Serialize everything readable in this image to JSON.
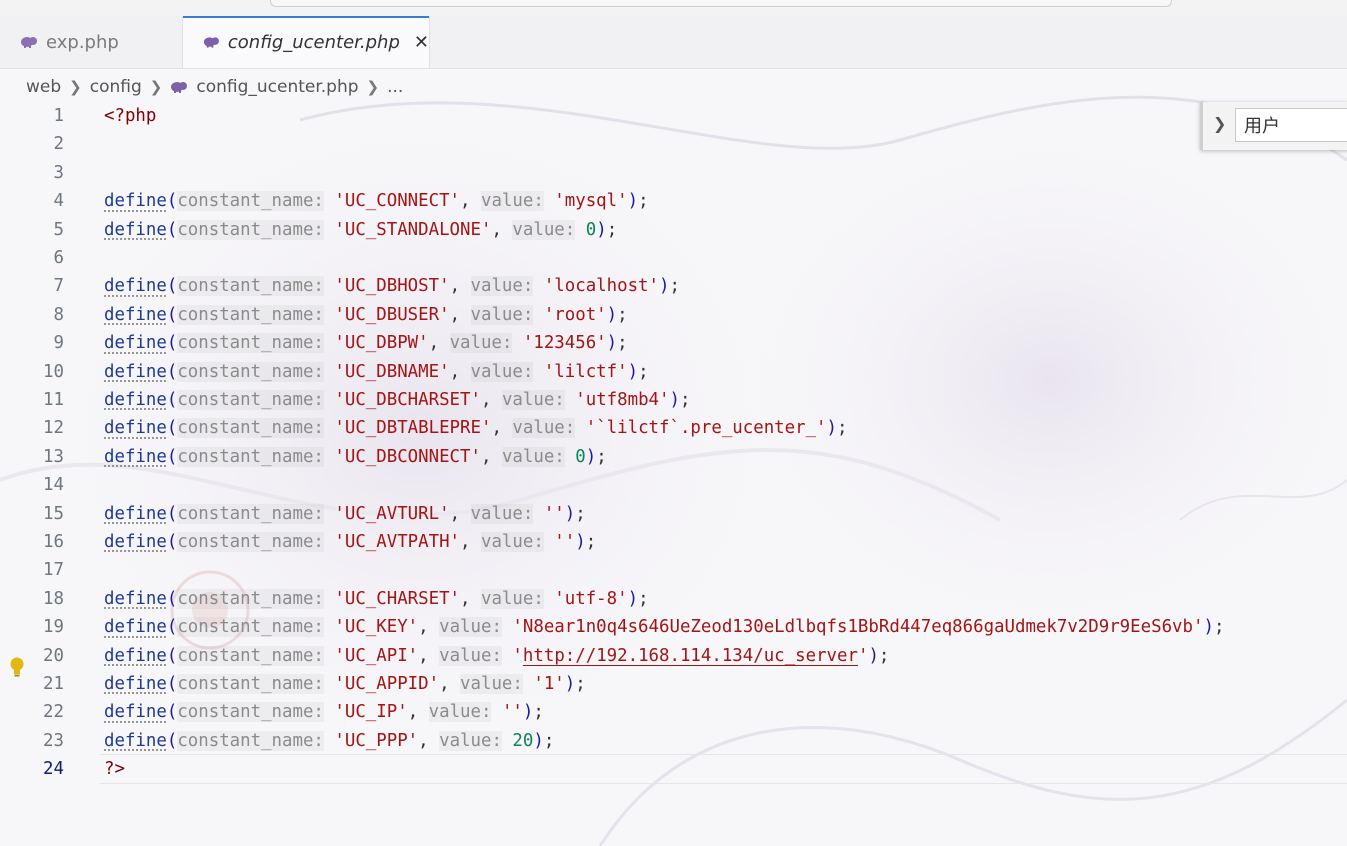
{
  "tabs": [
    {
      "label": "exp.php",
      "icon": "php-icon",
      "active": false
    },
    {
      "label": "config_ucenter.php",
      "icon": "php-icon",
      "active": true,
      "close": "✕"
    }
  ],
  "breadcrumb": {
    "items": [
      "web",
      "config",
      "config_ucenter.php",
      "..."
    ]
  },
  "find": {
    "toggle_icon": "chevron-right-icon",
    "value": "用户"
  },
  "editor": {
    "current_line": 24,
    "lines": [
      {
        "n": "1",
        "tokens": [
          {
            "t": "<?php",
            "c": "kw"
          }
        ]
      },
      {
        "n": "2",
        "tokens": []
      },
      {
        "n": "3",
        "tokens": []
      },
      {
        "n": "4",
        "tokens": [
          {
            "t": "define",
            "c": "fn"
          },
          {
            "t": "(",
            "c": "paren"
          },
          {
            "t": "constant_name:",
            "c": "hint"
          },
          {
            "t": " ",
            "c": "pun"
          },
          {
            "t": "'UC_CONNECT'",
            "c": "str"
          },
          {
            "t": ", ",
            "c": "pun"
          },
          {
            "t": "value:",
            "c": "hint"
          },
          {
            "t": " ",
            "c": "pun"
          },
          {
            "t": "'mysql'",
            "c": "str"
          },
          {
            "t": ")",
            "c": "paren"
          },
          {
            "t": ";",
            "c": "pun"
          }
        ]
      },
      {
        "n": "5",
        "tokens": [
          {
            "t": "define",
            "c": "fn"
          },
          {
            "t": "(",
            "c": "paren"
          },
          {
            "t": "constant_name:",
            "c": "hint"
          },
          {
            "t": " ",
            "c": "pun"
          },
          {
            "t": "'UC_STANDALONE'",
            "c": "str"
          },
          {
            "t": ", ",
            "c": "pun"
          },
          {
            "t": "value:",
            "c": "hint"
          },
          {
            "t": " ",
            "c": "pun"
          },
          {
            "t": "0",
            "c": "num"
          },
          {
            "t": ")",
            "c": "paren"
          },
          {
            "t": ";",
            "c": "pun"
          }
        ]
      },
      {
        "n": "6",
        "tokens": []
      },
      {
        "n": "7",
        "tokens": [
          {
            "t": "define",
            "c": "fn"
          },
          {
            "t": "(",
            "c": "paren"
          },
          {
            "t": "constant_name:",
            "c": "hint"
          },
          {
            "t": " ",
            "c": "pun"
          },
          {
            "t": "'UC_DBHOST'",
            "c": "str"
          },
          {
            "t": ", ",
            "c": "pun"
          },
          {
            "t": "value:",
            "c": "hint"
          },
          {
            "t": " ",
            "c": "pun"
          },
          {
            "t": "'localhost'",
            "c": "str"
          },
          {
            "t": ")",
            "c": "paren"
          },
          {
            "t": ";",
            "c": "pun"
          }
        ]
      },
      {
        "n": "8",
        "tokens": [
          {
            "t": "define",
            "c": "fn"
          },
          {
            "t": "(",
            "c": "paren"
          },
          {
            "t": "constant_name:",
            "c": "hint"
          },
          {
            "t": " ",
            "c": "pun"
          },
          {
            "t": "'UC_DBUSER'",
            "c": "str"
          },
          {
            "t": ", ",
            "c": "pun"
          },
          {
            "t": "value:",
            "c": "hint"
          },
          {
            "t": " ",
            "c": "pun"
          },
          {
            "t": "'root'",
            "c": "str"
          },
          {
            "t": ")",
            "c": "paren"
          },
          {
            "t": ";",
            "c": "pun"
          }
        ]
      },
      {
        "n": "9",
        "tokens": [
          {
            "t": "define",
            "c": "fn"
          },
          {
            "t": "(",
            "c": "paren"
          },
          {
            "t": "constant_name:",
            "c": "hint"
          },
          {
            "t": " ",
            "c": "pun"
          },
          {
            "t": "'UC_DBPW'",
            "c": "str"
          },
          {
            "t": ", ",
            "c": "pun"
          },
          {
            "t": "value:",
            "c": "hint"
          },
          {
            "t": " ",
            "c": "pun"
          },
          {
            "t": "'123456'",
            "c": "str"
          },
          {
            "t": ")",
            "c": "paren"
          },
          {
            "t": ";",
            "c": "pun"
          }
        ]
      },
      {
        "n": "10",
        "tokens": [
          {
            "t": "define",
            "c": "fn"
          },
          {
            "t": "(",
            "c": "paren"
          },
          {
            "t": "constant_name:",
            "c": "hint"
          },
          {
            "t": " ",
            "c": "pun"
          },
          {
            "t": "'UC_DBNAME'",
            "c": "str"
          },
          {
            "t": ", ",
            "c": "pun"
          },
          {
            "t": "value:",
            "c": "hint"
          },
          {
            "t": " ",
            "c": "pun"
          },
          {
            "t": "'lilctf'",
            "c": "str"
          },
          {
            "t": ")",
            "c": "paren"
          },
          {
            "t": ";",
            "c": "pun"
          }
        ]
      },
      {
        "n": "11",
        "tokens": [
          {
            "t": "define",
            "c": "fn"
          },
          {
            "t": "(",
            "c": "paren"
          },
          {
            "t": "constant_name:",
            "c": "hint"
          },
          {
            "t": " ",
            "c": "pun"
          },
          {
            "t": "'UC_DBCHARSET'",
            "c": "str"
          },
          {
            "t": ", ",
            "c": "pun"
          },
          {
            "t": "value:",
            "c": "hint"
          },
          {
            "t": " ",
            "c": "pun"
          },
          {
            "t": "'utf8mb4'",
            "c": "str"
          },
          {
            "t": ")",
            "c": "paren"
          },
          {
            "t": ";",
            "c": "pun"
          }
        ]
      },
      {
        "n": "12",
        "tokens": [
          {
            "t": "define",
            "c": "fn"
          },
          {
            "t": "(",
            "c": "paren"
          },
          {
            "t": "constant_name:",
            "c": "hint"
          },
          {
            "t": " ",
            "c": "pun"
          },
          {
            "t": "'UC_DBTABLEPRE'",
            "c": "str"
          },
          {
            "t": ", ",
            "c": "pun"
          },
          {
            "t": "value:",
            "c": "hint"
          },
          {
            "t": " ",
            "c": "pun"
          },
          {
            "t": "'`lilctf`.pre_ucenter_'",
            "c": "str"
          },
          {
            "t": ")",
            "c": "paren"
          },
          {
            "t": ";",
            "c": "pun"
          }
        ]
      },
      {
        "n": "13",
        "tokens": [
          {
            "t": "define",
            "c": "fn"
          },
          {
            "t": "(",
            "c": "paren"
          },
          {
            "t": "constant_name:",
            "c": "hint"
          },
          {
            "t": " ",
            "c": "pun"
          },
          {
            "t": "'UC_DBCONNECT'",
            "c": "str"
          },
          {
            "t": ", ",
            "c": "pun"
          },
          {
            "t": "value:",
            "c": "hint"
          },
          {
            "t": " ",
            "c": "pun"
          },
          {
            "t": "0",
            "c": "num"
          },
          {
            "t": ")",
            "c": "paren"
          },
          {
            "t": ";",
            "c": "pun"
          }
        ]
      },
      {
        "n": "14",
        "tokens": []
      },
      {
        "n": "15",
        "tokens": [
          {
            "t": "define",
            "c": "fn"
          },
          {
            "t": "(",
            "c": "paren"
          },
          {
            "t": "constant_name:",
            "c": "hint"
          },
          {
            "t": " ",
            "c": "pun"
          },
          {
            "t": "'UC_AVTURL'",
            "c": "str"
          },
          {
            "t": ", ",
            "c": "pun"
          },
          {
            "t": "value:",
            "c": "hint"
          },
          {
            "t": " ",
            "c": "pun"
          },
          {
            "t": "''",
            "c": "str"
          },
          {
            "t": ")",
            "c": "paren"
          },
          {
            "t": ";",
            "c": "pun"
          }
        ]
      },
      {
        "n": "16",
        "tokens": [
          {
            "t": "define",
            "c": "fn"
          },
          {
            "t": "(",
            "c": "paren"
          },
          {
            "t": "constant_name:",
            "c": "hint"
          },
          {
            "t": " ",
            "c": "pun"
          },
          {
            "t": "'UC_AVTPATH'",
            "c": "str"
          },
          {
            "t": ", ",
            "c": "pun"
          },
          {
            "t": "value:",
            "c": "hint"
          },
          {
            "t": " ",
            "c": "pun"
          },
          {
            "t": "''",
            "c": "str"
          },
          {
            "t": ")",
            "c": "paren"
          },
          {
            "t": ";",
            "c": "pun"
          }
        ]
      },
      {
        "n": "17",
        "tokens": []
      },
      {
        "n": "18",
        "tokens": [
          {
            "t": "define",
            "c": "fn"
          },
          {
            "t": "(",
            "c": "paren"
          },
          {
            "t": "constant_name:",
            "c": "hint"
          },
          {
            "t": " ",
            "c": "pun"
          },
          {
            "t": "'UC_CHARSET'",
            "c": "str"
          },
          {
            "t": ", ",
            "c": "pun"
          },
          {
            "t": "value:",
            "c": "hint"
          },
          {
            "t": " ",
            "c": "pun"
          },
          {
            "t": "'utf-8'",
            "c": "str"
          },
          {
            "t": ")",
            "c": "paren"
          },
          {
            "t": ";",
            "c": "pun"
          }
        ]
      },
      {
        "n": "19",
        "tokens": [
          {
            "t": "define",
            "c": "fn"
          },
          {
            "t": "(",
            "c": "paren"
          },
          {
            "t": "constant_name:",
            "c": "hint"
          },
          {
            "t": " ",
            "c": "pun"
          },
          {
            "t": "'UC_KEY'",
            "c": "str"
          },
          {
            "t": ", ",
            "c": "pun"
          },
          {
            "t": "value:",
            "c": "hint"
          },
          {
            "t": " ",
            "c": "pun"
          },
          {
            "t": "'N8ear1n0q4s646UeZeod130eLdlbqfs1BbRd447eq866gaUdmek7v2D9r9EeS6vb'",
            "c": "str"
          },
          {
            "t": ")",
            "c": "paren"
          },
          {
            "t": ";",
            "c": "pun"
          }
        ]
      },
      {
        "n": "20",
        "tokens": [
          {
            "t": "define",
            "c": "fn"
          },
          {
            "t": "(",
            "c": "paren"
          },
          {
            "t": "constant_name:",
            "c": "hint"
          },
          {
            "t": " ",
            "c": "pun"
          },
          {
            "t": "'UC_API'",
            "c": "str"
          },
          {
            "t": ", ",
            "c": "pun"
          },
          {
            "t": "value:",
            "c": "hint"
          },
          {
            "t": " ",
            "c": "pun"
          },
          {
            "t": "'",
            "c": "str"
          },
          {
            "t": "http://192.168.114.134/uc_server",
            "c": "url"
          },
          {
            "t": "'",
            "c": "str"
          },
          {
            "t": ")",
            "c": "paren"
          },
          {
            "t": ";",
            "c": "pun"
          }
        ]
      },
      {
        "n": "21",
        "tokens": [
          {
            "t": "define",
            "c": "fn"
          },
          {
            "t": "(",
            "c": "paren"
          },
          {
            "t": "constant_name:",
            "c": "hint"
          },
          {
            "t": " ",
            "c": "pun"
          },
          {
            "t": "'UC_APPID'",
            "c": "str"
          },
          {
            "t": ", ",
            "c": "pun"
          },
          {
            "t": "value:",
            "c": "hint"
          },
          {
            "t": " ",
            "c": "pun"
          },
          {
            "t": "'1'",
            "c": "str"
          },
          {
            "t": ")",
            "c": "paren"
          },
          {
            "t": ";",
            "c": "pun"
          }
        ]
      },
      {
        "n": "22",
        "tokens": [
          {
            "t": "define",
            "c": "fn"
          },
          {
            "t": "(",
            "c": "paren"
          },
          {
            "t": "constant_name:",
            "c": "hint"
          },
          {
            "t": " ",
            "c": "pun"
          },
          {
            "t": "'UC_IP'",
            "c": "str"
          },
          {
            "t": ", ",
            "c": "pun"
          },
          {
            "t": "value:",
            "c": "hint"
          },
          {
            "t": " ",
            "c": "pun"
          },
          {
            "t": "''",
            "c": "str"
          },
          {
            "t": ")",
            "c": "paren"
          },
          {
            "t": ";",
            "c": "pun"
          }
        ]
      },
      {
        "n": "23",
        "tokens": [
          {
            "t": "define",
            "c": "fn"
          },
          {
            "t": "(",
            "c": "paren"
          },
          {
            "t": "constant_name:",
            "c": "hint"
          },
          {
            "t": " ",
            "c": "pun"
          },
          {
            "t": "'UC_PPP'",
            "c": "str"
          },
          {
            "t": ", ",
            "c": "pun"
          },
          {
            "t": "value:",
            "c": "hint"
          },
          {
            "t": " ",
            "c": "pun"
          },
          {
            "t": "20",
            "c": "num"
          },
          {
            "t": ")",
            "c": "paren"
          },
          {
            "t": ";",
            "c": "pun"
          }
        ]
      },
      {
        "n": "24",
        "tokens": [
          {
            "t": "?>",
            "c": "kw"
          }
        ]
      }
    ]
  },
  "colors": {
    "keyword": "#800000",
    "function": "#1f3a93",
    "string": "#a31515",
    "number": "#098658",
    "inlay_hint": "#8b8b8b",
    "line_number": "#6e7681",
    "active_line_number": "#0b216f",
    "tab_accent": "#3a7bd5",
    "lightbulb": "#e2b714"
  }
}
